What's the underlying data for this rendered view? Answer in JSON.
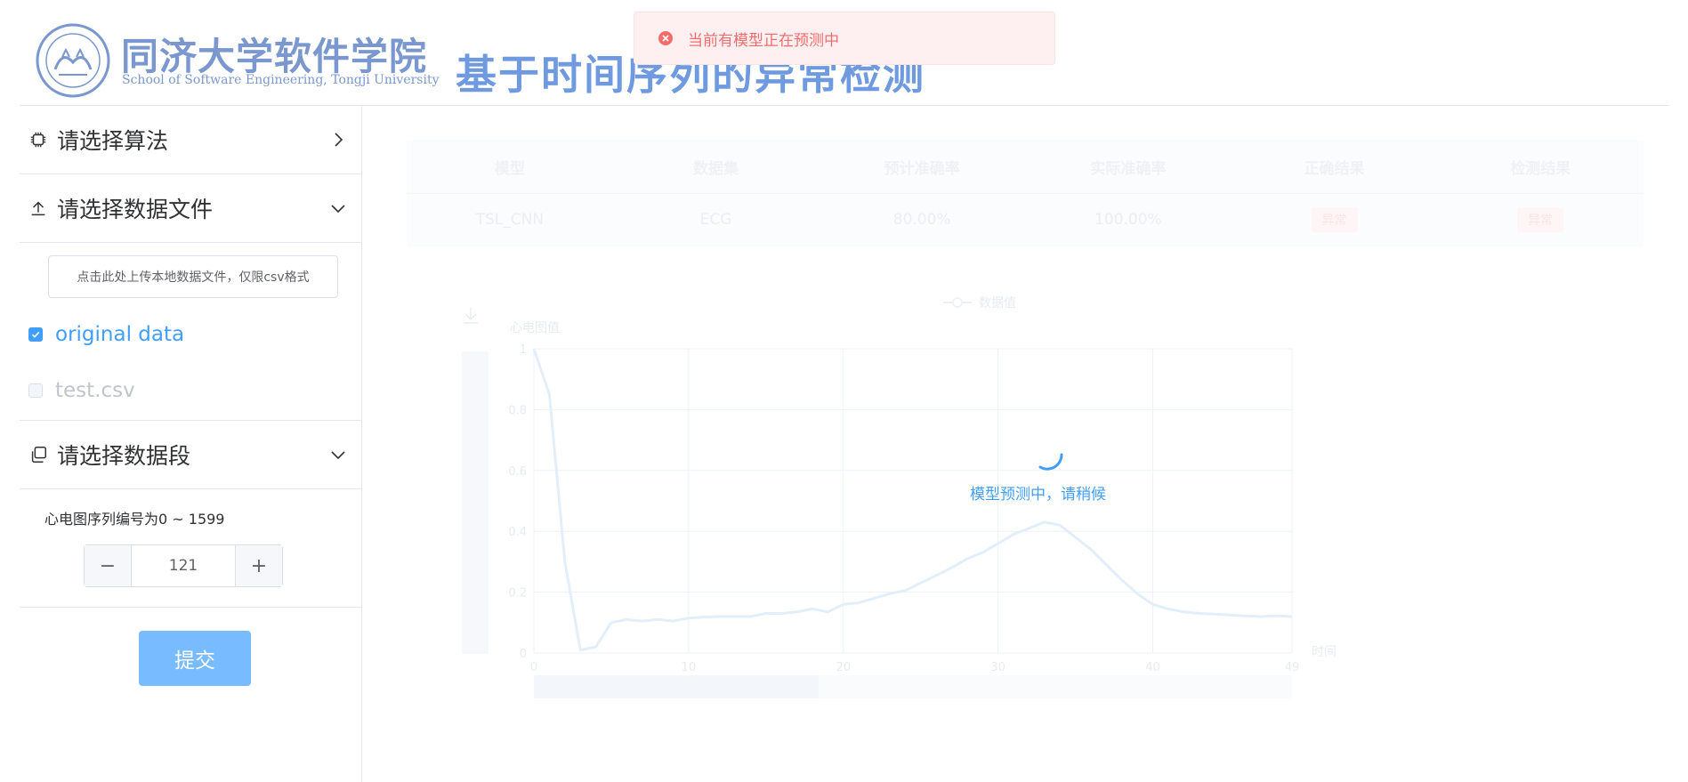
{
  "header": {
    "logo_cn": "同济大学软件学院",
    "logo_en": "School of Software Engineering, Tongji University",
    "title": "基于时间序列的异常检测"
  },
  "toast": {
    "message": "当前有模型正在预测中",
    "type": "error",
    "color": "#f56c6c"
  },
  "sidebar": {
    "algorithm": {
      "label": "请选择算法",
      "icon": "chip-icon",
      "expanded": false
    },
    "data_file": {
      "label": "请选择数据文件",
      "icon": "upload-icon",
      "expanded": true
    },
    "upload_hint": "点击此处上传本地数据文件，仅限csv格式",
    "files": [
      {
        "label": "original data",
        "checked": true
      },
      {
        "label": "test.csv",
        "checked": false,
        "disabled": true
      }
    ],
    "segment": {
      "label": "请选择数据段",
      "icon": "copy-icon",
      "expanded": true
    },
    "range_text": "心电图序列编号为0 ~ 1599",
    "stepper": {
      "value": "121",
      "minus": "−",
      "plus": "+"
    },
    "submit_label": "提交"
  },
  "table": {
    "headers": [
      "模型",
      "数据集",
      "预计准确率",
      "实际准确率",
      "正确结果",
      "检测结果"
    ],
    "rows": [
      [
        "TSL_CNN",
        "ECG",
        "80.00%",
        "100.00%",
        "异常",
        "异常"
      ]
    ]
  },
  "loading": {
    "text": "模型预测中，请稍候"
  },
  "chart_data": {
    "type": "line",
    "legend": "数据值",
    "ylabel": "心电图值",
    "xlabel": "时间",
    "xlim": [
      0,
      49
    ],
    "ylim": [
      0,
      1
    ],
    "x_ticks": [
      0,
      10,
      20,
      30,
      40,
      49
    ],
    "y_ticks": [
      0,
      0.2,
      0.4,
      0.6,
      0.8,
      1
    ],
    "series": [
      {
        "name": "数据值",
        "x": [
          0,
          1,
          2,
          3,
          4,
          5,
          6,
          7,
          8,
          9,
          10,
          11,
          12,
          13,
          14,
          15,
          16,
          17,
          18,
          19,
          20,
          21,
          22,
          23,
          24,
          25,
          26,
          27,
          28,
          29,
          30,
          31,
          32,
          33,
          34,
          35,
          36,
          37,
          38,
          39,
          40,
          41,
          42,
          43,
          44,
          45,
          46,
          47,
          48,
          49
        ],
        "values": [
          1.0,
          0.85,
          0.3,
          0.01,
          0.02,
          0.1,
          0.11,
          0.105,
          0.11,
          0.105,
          0.115,
          0.118,
          0.12,
          0.12,
          0.12,
          0.13,
          0.13,
          0.135,
          0.145,
          0.135,
          0.16,
          0.165,
          0.18,
          0.195,
          0.205,
          0.23,
          0.255,
          0.28,
          0.31,
          0.33,
          0.36,
          0.39,
          0.41,
          0.43,
          0.42,
          0.38,
          0.34,
          0.29,
          0.24,
          0.195,
          0.16,
          0.145,
          0.135,
          0.13,
          0.128,
          0.125,
          0.122,
          0.12,
          0.122,
          0.12
        ]
      }
    ],
    "line_color": "#e3eefb"
  }
}
